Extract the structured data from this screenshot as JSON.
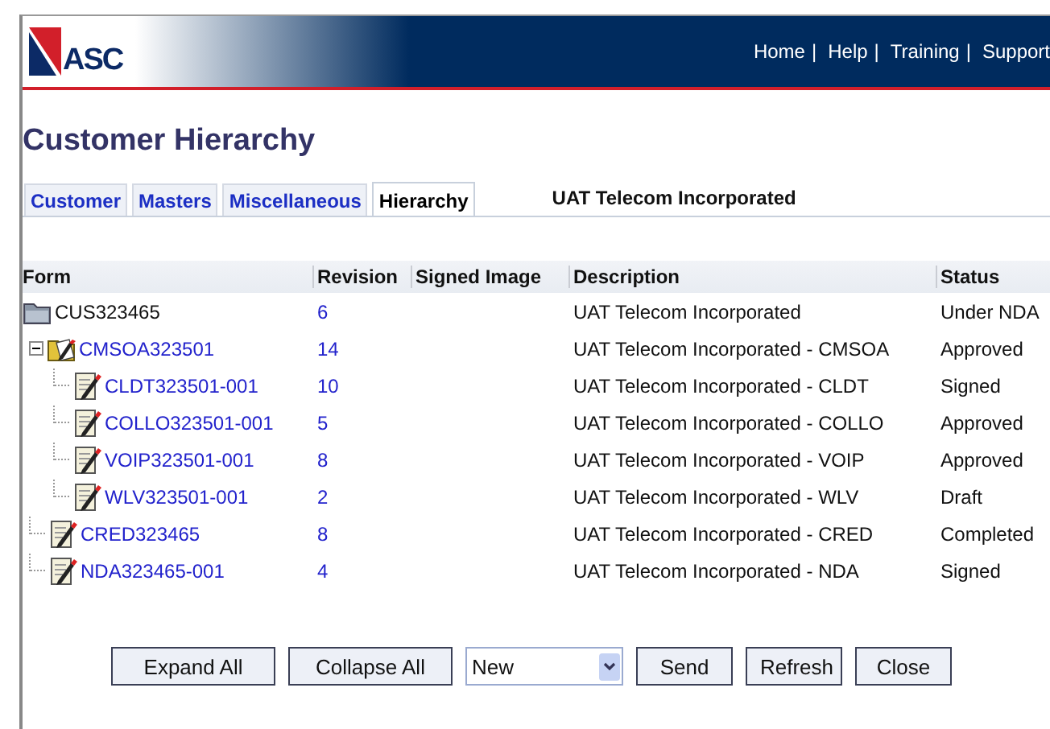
{
  "header": {
    "logo": "ASC",
    "nav": [
      {
        "label": "Home",
        "separator": "|"
      },
      {
        "label": "Help",
        "separator": "|"
      },
      {
        "label": "Training",
        "separator": "|"
      },
      {
        "label": "Support"
      }
    ]
  },
  "title": "Customer Hierarchy",
  "tabs": [
    {
      "label": "Customer",
      "selected": false
    },
    {
      "label": "Masters",
      "selected": false
    },
    {
      "label": "Miscellaneous",
      "selected": false
    },
    {
      "label": "Hierarchy",
      "selected": true
    }
  ],
  "customer_name": "UAT Telecom Incorporated",
  "table": {
    "columns": [
      "Form",
      "Revision",
      "Signed Image",
      "Description",
      "Status"
    ],
    "rows": [
      {
        "kind": "folder",
        "form": "CUS323465",
        "link": false,
        "revision": "6",
        "description": "UAT Telecom Incorporated",
        "status": "Under NDA",
        "children": [
          {
            "kind": "open-folder",
            "form": "CMSOA323501",
            "link": true,
            "expanded": true,
            "revision": "14",
            "description": "UAT Telecom Incorporated - CMSOA",
            "status": "Approved",
            "children": [
              {
                "kind": "document",
                "form": "CLDT323501-001",
                "link": true,
                "revision": "10",
                "description": "UAT Telecom Incorporated - CLDT",
                "status": "Signed"
              },
              {
                "kind": "document",
                "form": "COLLO323501-001",
                "link": true,
                "revision": "5",
                "description": "UAT Telecom Incorporated - COLLO",
                "status": "Approved"
              },
              {
                "kind": "document",
                "form": "VOIP323501-001",
                "link": true,
                "revision": "8",
                "description": "UAT Telecom Incorporated - VOIP",
                "status": "Approved"
              },
              {
                "kind": "document",
                "form": "WLV323501-001",
                "link": true,
                "revision": "2",
                "description": "UAT Telecom Incorporated - WLV",
                "status": "Draft"
              }
            ]
          },
          {
            "kind": "document",
            "form": "CRED323465",
            "link": true,
            "revision": "8",
            "description": "UAT Telecom Incorporated - CRED",
            "status": "Completed"
          },
          {
            "kind": "document",
            "form": "NDA323465-001",
            "link": true,
            "revision": "4",
            "description": "UAT Telecom Incorporated - NDA",
            "status": "Signed"
          }
        ]
      }
    ]
  },
  "actions": [
    {
      "kind": "button",
      "label": "Expand All"
    },
    {
      "kind": "button",
      "label": "Collapse All"
    },
    {
      "kind": "select",
      "value": "New"
    },
    {
      "kind": "button",
      "label": "Send"
    },
    {
      "kind": "button",
      "label": "Refresh"
    },
    {
      "kind": "button",
      "label": "Close"
    }
  ]
}
